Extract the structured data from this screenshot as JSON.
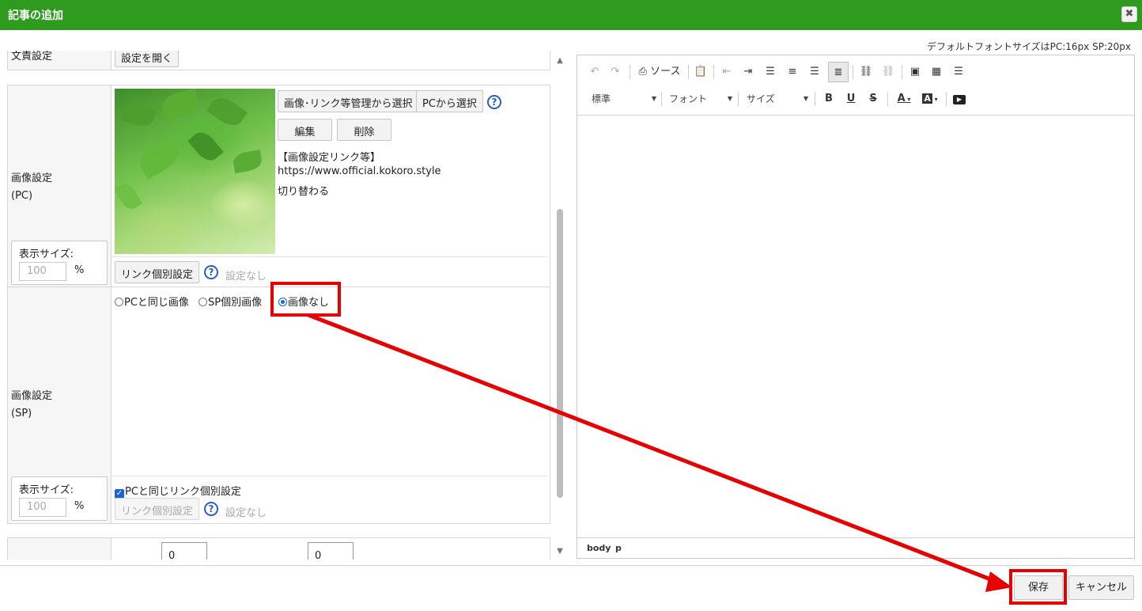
{
  "dialog": {
    "title": "記事の追加",
    "close_glyph": "✖",
    "font_note": "デフォルトフォントサイズはPC:16px SP:20px"
  },
  "form": {
    "top_row": {
      "label": "文責設定",
      "button": "設定を開く"
    },
    "image_pc": {
      "label_line1": "画像設定",
      "label_line2": "(PC)",
      "select_manage_button": "画像･リンク等管理から選択",
      "select_pc_button": "PCから選択",
      "help": "?",
      "edit_button": "編集",
      "delete_button": "削除",
      "link_info_title": "【画像設定リンク等】",
      "link_info_url": "https://www.official.kokoro.style",
      "link_info_note": "切り替わる",
      "display_size_label": "表示サイズ:",
      "display_size_value": "100",
      "display_size_unit": "%",
      "link_button": "リンク個別設定",
      "link_status": "設定なし"
    },
    "image_sp": {
      "label_line1": "画像設定",
      "label_line2": "(SP)",
      "options": [
        {
          "label": "PCと同じ画像",
          "selected": false
        },
        {
          "label": "SP個別画像",
          "selected": false
        },
        {
          "label": "画像なし",
          "selected": true
        }
      ],
      "same_link_checkbox": "PCと同じリンク個別設定",
      "same_link_checked": true,
      "display_size_label": "表示サイズ:",
      "display_size_value": "100",
      "display_size_unit": "%",
      "link_button": "リンク個別設定",
      "link_status": "設定なし",
      "help": "?"
    },
    "bottom_row": {
      "value_a": "0",
      "value_b": "0"
    }
  },
  "editor": {
    "source_label": "ソース",
    "format_combo": "標準",
    "font_combo": "フォント",
    "size_combo": "サイズ",
    "bold": "B",
    "underline": "U",
    "strike": "S",
    "text_color": "A",
    "bg_color": "A",
    "status_path": [
      "body",
      "p"
    ]
  },
  "footer": {
    "save_button": "保存",
    "cancel_button": "キャンセル"
  },
  "colors": {
    "title_bar": "#2e9a1e",
    "annotation": "#e60000",
    "accent": "#1a63d8"
  }
}
